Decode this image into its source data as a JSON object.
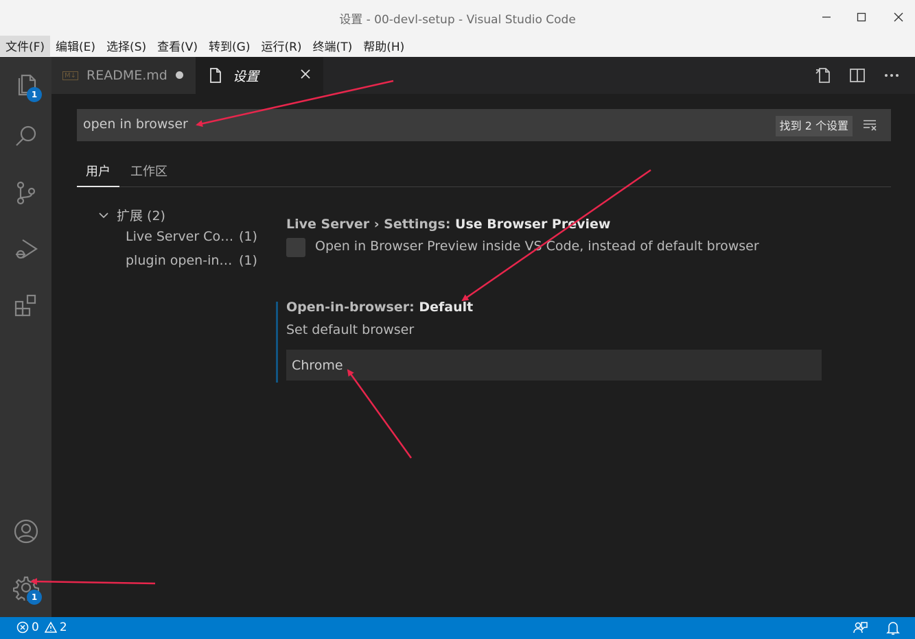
{
  "window": {
    "title": "设置 - 00-devl-setup - Visual Studio Code",
    "minimize": "—",
    "maximize": "☐",
    "close": "✕"
  },
  "menu": [
    "文件(F)",
    "编辑(E)",
    "选择(S)",
    "查看(V)",
    "转到(G)",
    "运行(R)",
    "终端(T)",
    "帮助(H)"
  ],
  "activity": {
    "explorer_badge": "1",
    "manage_badge": "1",
    "icons": [
      "files-icon",
      "search-icon",
      "source-control-icon",
      "run-debug-icon",
      "extensions-icon",
      "account-icon",
      "gear-icon"
    ]
  },
  "tabs": {
    "readme": {
      "icon": "M↓",
      "label": "README.md"
    },
    "settings": {
      "label": "设置"
    }
  },
  "search": {
    "value": "open in browser",
    "count": "找到 2 个设置"
  },
  "scope_tabs": {
    "user": "用户",
    "workspace": "工作区"
  },
  "toc": {
    "header": "扩展 (2)",
    "items": [
      {
        "label": "Live Server Co…",
        "count": "(1)"
      },
      {
        "label": "plugin open-in…",
        "count": "(1)"
      }
    ]
  },
  "settings": [
    {
      "category": "Live Server › Settings: ",
      "key": "Use Browser Preview",
      "description": "Open in Browser Preview inside VS Code, instead of default browser",
      "checked": false
    },
    {
      "category": "Open-in-browser: ",
      "key": "Default",
      "description": "Set default browser",
      "value": "Chrome"
    }
  ],
  "status": {
    "errors": "0",
    "warnings": "2"
  },
  "colors": {
    "accent": "#007acc",
    "annotation": "#e8264c",
    "badge": "#0e70c0"
  }
}
